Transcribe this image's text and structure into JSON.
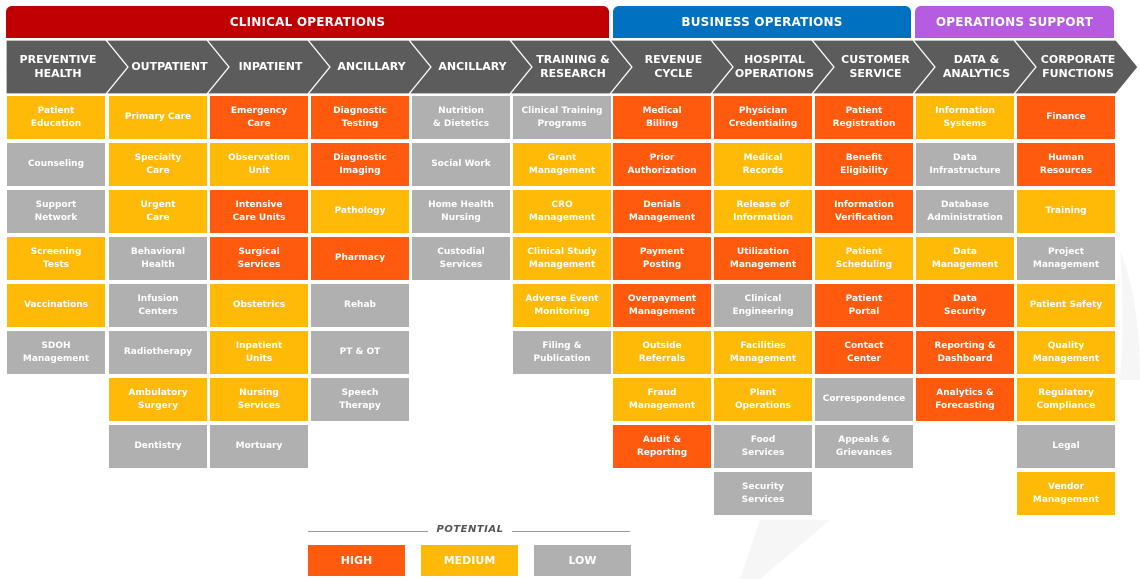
{
  "colors": {
    "high": "#FF5A0E",
    "medium": "#FFBA08",
    "low": "#B0B0B0",
    "chevron": "#5C5C5C",
    "clinical": "#C00000",
    "business": "#0070C0",
    "support": "#B55CE0"
  },
  "groups": [
    {
      "label": "CLINICAL OPERATIONS",
      "color_key": "clinical"
    },
    {
      "label": "BUSINESS OPERATIONS",
      "color_key": "business"
    },
    {
      "label": "OPERATIONS SUPPORT",
      "color_key": "support"
    }
  ],
  "columns": [
    {
      "title": "PREVENTIVE\nHEALTH",
      "group": "clinical",
      "items": [
        {
          "label": "Patient\nEducation",
          "potential": "medium"
        },
        {
          "label": "Counseling",
          "potential": "low"
        },
        {
          "label": "Support\nNetwork",
          "potential": "low"
        },
        {
          "label": "Screening\nTests",
          "potential": "medium"
        },
        {
          "label": "Vaccinations",
          "potential": "medium"
        },
        {
          "label": "SDOH\nManagement",
          "potential": "low"
        }
      ]
    },
    {
      "title": "OUTPATIENT",
      "group": "clinical",
      "items": [
        {
          "label": "Primary Care",
          "potential": "medium"
        },
        {
          "label": "Specialty\nCare",
          "potential": "medium"
        },
        {
          "label": "Urgent\nCare",
          "potential": "medium"
        },
        {
          "label": "Behavioral\nHealth",
          "potential": "low"
        },
        {
          "label": "Infusion\nCenters",
          "potential": "low"
        },
        {
          "label": "Radiotherapy",
          "potential": "low"
        },
        {
          "label": "Ambulatory\nSurgery",
          "potential": "medium"
        },
        {
          "label": "Dentistry",
          "potential": "low"
        }
      ]
    },
    {
      "title": "INPATIENT",
      "group": "clinical",
      "items": [
        {
          "label": "Emergency\nCare",
          "potential": "high"
        },
        {
          "label": "Observation\nUnit",
          "potential": "medium"
        },
        {
          "label": "Intensive\nCare Units",
          "potential": "high"
        },
        {
          "label": "Surgical\nServices",
          "potential": "high"
        },
        {
          "label": "Obstetrics",
          "potential": "medium"
        },
        {
          "label": "Inpatient\nUnits",
          "potential": "medium"
        },
        {
          "label": "Nursing\nServices",
          "potential": "medium"
        },
        {
          "label": "Mortuary",
          "potential": "low"
        }
      ]
    },
    {
      "title": "ANCILLARY",
      "group": "clinical",
      "items": [
        {
          "label": "Diagnostic\nTesting",
          "potential": "high"
        },
        {
          "label": "Diagnostic\nImaging",
          "potential": "high"
        },
        {
          "label": "Pathology",
          "potential": "medium"
        },
        {
          "label": "Pharmacy",
          "potential": "high"
        },
        {
          "label": "Rehab",
          "potential": "low"
        },
        {
          "label": "PT & OT",
          "potential": "low"
        },
        {
          "label": "Speech\nTherapy",
          "potential": "low"
        }
      ]
    },
    {
      "title": "ANCILLARY",
      "group": "clinical",
      "items": [
        {
          "label": "Nutrition\n& Dietetics",
          "potential": "low"
        },
        {
          "label": "Social Work",
          "potential": "low"
        },
        {
          "label": "Home Health\nNursing",
          "potential": "low"
        },
        {
          "label": "Custodial\nServices",
          "potential": "low"
        }
      ]
    },
    {
      "title": "TRAINING &\nRESEARCH",
      "group": "clinical",
      "items": [
        {
          "label": "Clinical Training\nPrograms",
          "potential": "low"
        },
        {
          "label": "Grant\nManagement",
          "potential": "medium"
        },
        {
          "label": "CRO\nManagement",
          "potential": "medium"
        },
        {
          "label": "Clinical Study\nManagement",
          "potential": "medium"
        },
        {
          "label": "Adverse Event\nMonitoring",
          "potential": "medium"
        },
        {
          "label": "Filing &\nPublication",
          "potential": "low"
        }
      ]
    },
    {
      "title": "REVENUE\nCYCLE",
      "group": "business",
      "items": [
        {
          "label": "Medical\nBilling",
          "potential": "high"
        },
        {
          "label": "Prior\nAuthorization",
          "potential": "high"
        },
        {
          "label": "Denials\nManagement",
          "potential": "high"
        },
        {
          "label": "Payment\nPosting",
          "potential": "high"
        },
        {
          "label": "Overpayment\nManagement",
          "potential": "high"
        },
        {
          "label": "Outside\nReferrals",
          "potential": "medium"
        },
        {
          "label": "Fraud\nManagement",
          "potential": "medium"
        },
        {
          "label": "Audit &\nReporting",
          "potential": "high"
        }
      ]
    },
    {
      "title": "HOSPITAL\nOPERATIONS",
      "group": "business",
      "items": [
        {
          "label": "Physician\nCredentialing",
          "potential": "high"
        },
        {
          "label": "Medical\nRecords",
          "potential": "medium"
        },
        {
          "label": "Release of\nInformation",
          "potential": "medium"
        },
        {
          "label": "Utilization\nManagement",
          "potential": "high"
        },
        {
          "label": "Clinical\nEngineering",
          "potential": "low"
        },
        {
          "label": "Facilities\nManagement",
          "potential": "medium"
        },
        {
          "label": "Plant\nOperations",
          "potential": "medium"
        },
        {
          "label": "Food\nServices",
          "potential": "low"
        },
        {
          "label": "Security\nServices",
          "potential": "low"
        }
      ]
    },
    {
      "title": "CUSTOMER\nSERVICE",
      "group": "business",
      "items": [
        {
          "label": "Patient\nRegistration",
          "potential": "high"
        },
        {
          "label": "Benefit\nEligibility",
          "potential": "high"
        },
        {
          "label": "Information\nVerification",
          "potential": "high"
        },
        {
          "label": "Patient\nScheduling",
          "potential": "medium"
        },
        {
          "label": "Patient\nPortal",
          "potential": "high"
        },
        {
          "label": "Contact\nCenter",
          "potential": "high"
        },
        {
          "label": "Correspondence",
          "potential": "low"
        },
        {
          "label": "Appeals &\nGrievances",
          "potential": "low"
        }
      ]
    },
    {
      "title": "DATA &\nANALYTICS",
      "group": "support",
      "items": [
        {
          "label": "Information\nSystems",
          "potential": "medium"
        },
        {
          "label": "Data\nInfrastructure",
          "potential": "low"
        },
        {
          "label": "Database\nAdministration",
          "potential": "low"
        },
        {
          "label": "Data\nManagement",
          "potential": "medium"
        },
        {
          "label": "Data\nSecurity",
          "potential": "high"
        },
        {
          "label": "Reporting &\nDashboard",
          "potential": "high"
        },
        {
          "label": "Analytics &\nForecasting",
          "potential": "high"
        }
      ]
    },
    {
      "title": "CORPORATE\nFUNCTIONS",
      "group": "support",
      "items": [
        {
          "label": "Finance",
          "potential": "high"
        },
        {
          "label": "Human\nResources",
          "potential": "high"
        },
        {
          "label": "Training",
          "potential": "medium"
        },
        {
          "label": "Project\nManagement",
          "potential": "low"
        },
        {
          "label": "Patient Safety",
          "potential": "medium"
        },
        {
          "label": "Quality\nManagement",
          "potential": "medium"
        },
        {
          "label": "Regulatory\nCompliance",
          "potential": "medium"
        },
        {
          "label": "Legal",
          "potential": "low"
        },
        {
          "label": "Vendor\nManagement",
          "potential": "medium"
        }
      ]
    }
  ],
  "legend": {
    "title": "POTENTIAL",
    "items": [
      {
        "label": "HIGH",
        "potential": "high"
      },
      {
        "label": "MEDIUM",
        "potential": "medium"
      },
      {
        "label": "LOW",
        "potential": "low"
      }
    ]
  }
}
